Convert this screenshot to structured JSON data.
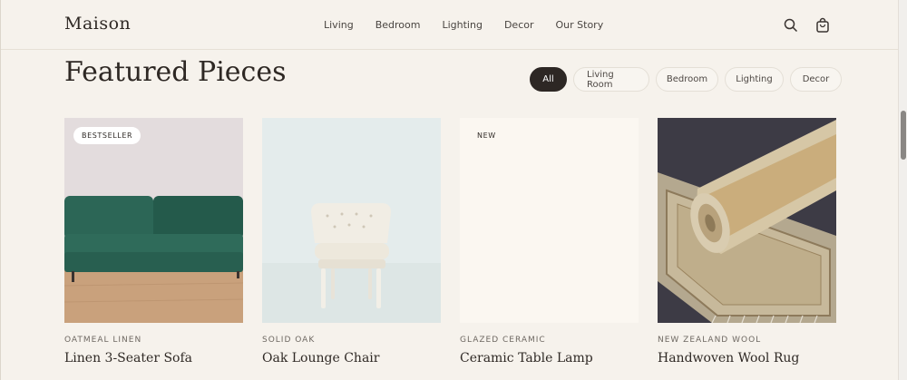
{
  "header": {
    "logo": "Maison",
    "nav": [
      "Living",
      "Bedroom",
      "Lighting",
      "Decor",
      "Our Story"
    ],
    "icons": [
      "search-icon",
      "bag-icon"
    ]
  },
  "section": {
    "title": "Featured Pieces",
    "filters": [
      "All",
      "Living Room",
      "Bedroom",
      "Lighting",
      "Decor"
    ],
    "active_filter": "All"
  },
  "products": [
    {
      "badge": "BESTSELLER",
      "kicker": "OATMEAL LINEN",
      "name": "Linen 3-Seater Sofa"
    },
    {
      "badge": "",
      "kicker": "SOLID OAK",
      "name": "Oak Lounge Chair"
    },
    {
      "badge": "NEW",
      "kicker": "GLAZED CERAMIC",
      "name": "Ceramic Table Lamp"
    },
    {
      "badge": "",
      "kicker": "NEW ZEALAND WOOL",
      "name": "Handwoven Wool Rug"
    }
  ],
  "colors": {
    "background": "#f6f2ec",
    "ink": "#2d2724",
    "accent_sofa": "#2f6b5a"
  }
}
